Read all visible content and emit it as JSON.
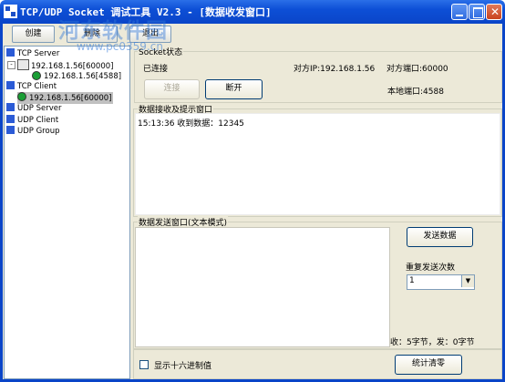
{
  "window": {
    "title": "TCP/UDP Socket 调试工具 V2.3 - [数据收发窗口]"
  },
  "watermark": {
    "text": "河东软件园",
    "url": "www.pc0359.cn"
  },
  "toolbar": {
    "create": "创建",
    "delete": "删除",
    "exit": "退出"
  },
  "tree": {
    "items": [
      "TCP Server",
      "192.168.1.56[60000]",
      "192.168.1.56[4588]",
      "TCP Client",
      "192.168.1.56[60000]",
      "UDP Server",
      "UDP Client",
      "UDP Group"
    ]
  },
  "socket": {
    "group_title": "Socket状态",
    "status": "已连接",
    "remote_ip": "对方IP:192.168.1.56",
    "remote_port": "对方端口:60000",
    "local_port": "本地端口:4588",
    "connect": "连接",
    "disconnect": "断开"
  },
  "receive": {
    "title": "数据接收及提示窗口",
    "log": "15:13:36 收到数据：12345"
  },
  "send": {
    "title": "数据发送窗口(文本模式)",
    "send_button": "发送数据",
    "repeat_label": "重复发送次数",
    "repeat_value": "1",
    "counter": "收：5字节，发：0字节"
  },
  "bottom": {
    "hex_label": "显示十六进制值",
    "clear_button": "统计清零"
  },
  "colors": {
    "titlebar": "#0a45c8",
    "window_bg": "#ece9d8",
    "selection": "#c0c0c0"
  }
}
